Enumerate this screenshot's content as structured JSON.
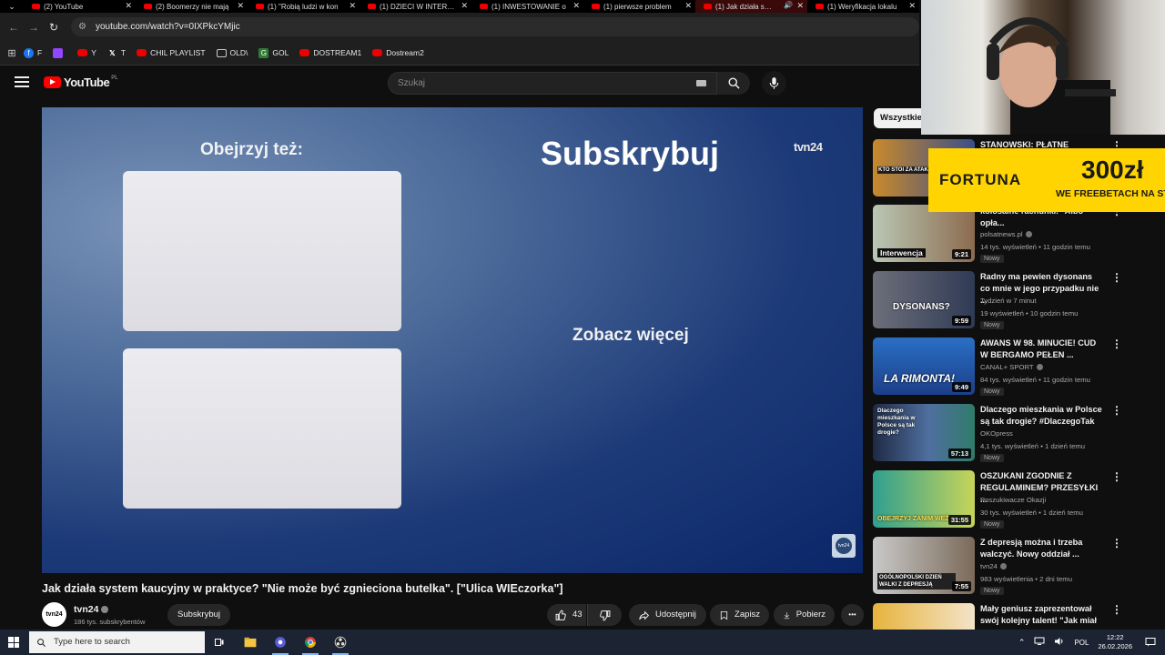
{
  "browser": {
    "tabs": [
      {
        "title": "(2) YouTube"
      },
      {
        "title": "(2) Boomerzy nie mają"
      },
      {
        "title": "(1) \"Robią ludzi w kon"
      },
      {
        "title": "(1) DZIECI W INTERNE"
      },
      {
        "title": "(1) INWESTOWANIE o"
      },
      {
        "title": "(1) pierwsze problem"
      },
      {
        "title": "(1) Jak działa syst"
      },
      {
        "title": "(1) Weryfikacja lokalu"
      }
    ],
    "close_glyph": "✕",
    "url": "youtube.com/watch?v=0IXPkcYMjic",
    "bookmarks": [
      {
        "label": "F",
        "icon": "facebook-icon",
        "color": "#1877f2"
      },
      {
        "label": "",
        "icon": "twitch-icon",
        "color": "#9146ff"
      },
      {
        "label": "Y",
        "icon": "youtube-icon",
        "color": "#e00000"
      },
      {
        "label": "T",
        "icon": "x-icon",
        "color": "#000000"
      },
      {
        "label": "CHIL PLAYLIST",
        "icon": "youtube-icon",
        "color": "#e00000"
      },
      {
        "label": "OLD\\",
        "icon": "folder-icon",
        "color": "#1f1f1f"
      },
      {
        "label": "GOL",
        "icon": "gol-icon",
        "color": "#2e7d32"
      },
      {
        "label": "DOSTREAM1",
        "icon": "youtube-icon",
        "color": "#e00000"
      },
      {
        "label": "Dostream2",
        "icon": "youtube-icon",
        "color": "#e00000"
      }
    ]
  },
  "header": {
    "logo_text": "YouTube",
    "country_code": "PL",
    "search_placeholder": "Szukaj"
  },
  "player": {
    "watch_also": "Obejrzyj też:",
    "subscribe_big": "Subskrybuj",
    "channel_logo": "tvn24",
    "see_more": "Zobacz więcej",
    "watermark": "tvn24"
  },
  "video": {
    "title": "Jak działa system kaucyjny w praktyce? \"Nie może być zgnieciona butelka\". [\"Ulica WIEczorka\"]",
    "channel": "tvn24",
    "avatar_text": "tvn24",
    "subscribers": "186 tys. subskrybentów",
    "subscribe_label": "Subskrybuj",
    "likes": "43",
    "share_label": "Udostępnij",
    "save_label": "Zapisz",
    "download_label": "Pobierz",
    "more_glyph": "•••"
  },
  "sidebar": {
    "chip": "Wszystkie",
    "items": [
      {
        "title": "STANOWSKI: PŁATNE",
        "channel": "",
        "meta": "",
        "badge": "",
        "duration": "",
        "thumb_tag": "KTO STOI ZA ATAKIEM"
      },
      {
        "title": "kolosalne rachunki. \"Albo opła...",
        "channel": "polsatnews.pl",
        "meta": "14 tys. wyświetleń • 11 godzin temu",
        "badge": "Nowy",
        "duration": "9:21",
        "thumb_tag": "Interwencja"
      },
      {
        "title": "Radny ma pewien dysonans co mnie w jego przypadku nie ...",
        "channel": "Tydzień w 7 minut",
        "meta": "19 wyświetleń • 10 godzin temu",
        "badge": "Nowy",
        "duration": "9:59",
        "thumb_tag": "DYSONANS?"
      },
      {
        "title": "AWANS W 98. MINUCIE! CUD W BERGAMO PEŁEN ...",
        "channel": "CANAL+ SPORT",
        "meta": "84 tys. wyświetleń • 11 godzin temu",
        "badge": "Nowy",
        "duration": "9:49",
        "thumb_tag": "LA RIMONTA!"
      },
      {
        "title": "Dlaczego mieszkania w Polsce są tak drogie? #DlaczegoTak",
        "channel": "OKOpress",
        "meta": "4,1 tys. wyświetleń • 1 dzień temu",
        "badge": "Nowy",
        "duration": "57:13",
        "thumb_tag": "Dlaczego mieszkania w Polsce są tak drogie?"
      },
      {
        "title": "OSZUKANI ZGODNIE Z REGULAMINEM? PRZESYŁKI ...",
        "channel": "Poszukiwacze Okazji",
        "meta": "30 tys. wyświetleń • 1 dzień temu",
        "badge": "Nowy",
        "duration": "31:55",
        "thumb_tag": "OBEJRZYJ ZANIM WEŹ"
      },
      {
        "title": "Z depresją można i trzeba walczyć. Nowy oddział ...",
        "channel": "tvn24",
        "meta": "983 wyświetlenia • 2 dni temu",
        "badge": "Nowy",
        "duration": "7:55",
        "thumb_tag": "OGÓLNOPOLSKI DZIEŃ WALKI Z DEPRESJĄ"
      },
      {
        "title": "Mały geniusz zaprezentował swój kolejny talent! \"Jak miał ...",
        "channel": "",
        "meta": "",
        "badge": "",
        "duration": "",
        "thumb_tag": ""
      }
    ],
    "kebab": "⋮"
  },
  "overlay": {
    "brand": "FORTUNA",
    "amount": "300zł",
    "tagline": "WE FREEBETACH NA START"
  },
  "taskbar": {
    "search_placeholder": "Type here to search",
    "language": "POL",
    "time": "12:22",
    "date": "26.02.2026"
  }
}
